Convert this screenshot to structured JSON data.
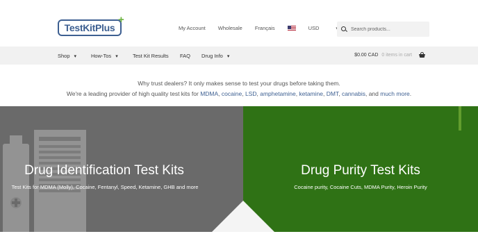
{
  "header": {
    "logo_text": "TestKitPlus",
    "logo_plus": "+",
    "links": [
      "My Account",
      "Wholesale",
      "Français"
    ],
    "currency": "USD",
    "search_placeholder": "Search products..."
  },
  "nav": {
    "items": [
      {
        "label": "Shop",
        "has_dropdown": true
      },
      {
        "label": "How-Tos",
        "has_dropdown": true
      },
      {
        "label": "Test Kit Results",
        "has_dropdown": false
      },
      {
        "label": "FAQ",
        "has_dropdown": false
      },
      {
        "label": "Drug Info",
        "has_dropdown": true
      }
    ],
    "cart_total": "$0.00 CAD",
    "cart_count": "0 items in cart"
  },
  "trust": {
    "line1": "Why trust dealers? It only makes sense to test your drugs before taking them.",
    "line2_prefix": "We're a leading provider of high quality test kits for ",
    "links": [
      "MDMA",
      "cocaine",
      "LSD",
      "amphetamine",
      "ketamine",
      "DMT",
      "cannabis"
    ],
    "line2_and": ", and ",
    "more": "much more",
    "line2_end": "."
  },
  "panels": {
    "left": {
      "title": "Drug Identification Test Kits",
      "subtitle": "Test Kits for MDMA (Molly), Cocaine, Fentanyl, Speed, Ketamine, GHB and more"
    },
    "right": {
      "title": "Drug Purity Test Kits",
      "subtitle": "Cocaine purity, Cocaine Cuts, MDMA Purity, Heroin Purity"
    }
  },
  "colors": {
    "brand_blue": "#3d5f91",
    "plus_green": "#6db33f",
    "left_panel": "#6a6a6a",
    "right_panel": "#2f7215",
    "nav_bg": "#f1f1f1"
  },
  "icons": {
    "search": "search-icon",
    "cart": "basket-icon",
    "flag": "us-flag-icon",
    "dropdown": "chevron-down-icon"
  }
}
